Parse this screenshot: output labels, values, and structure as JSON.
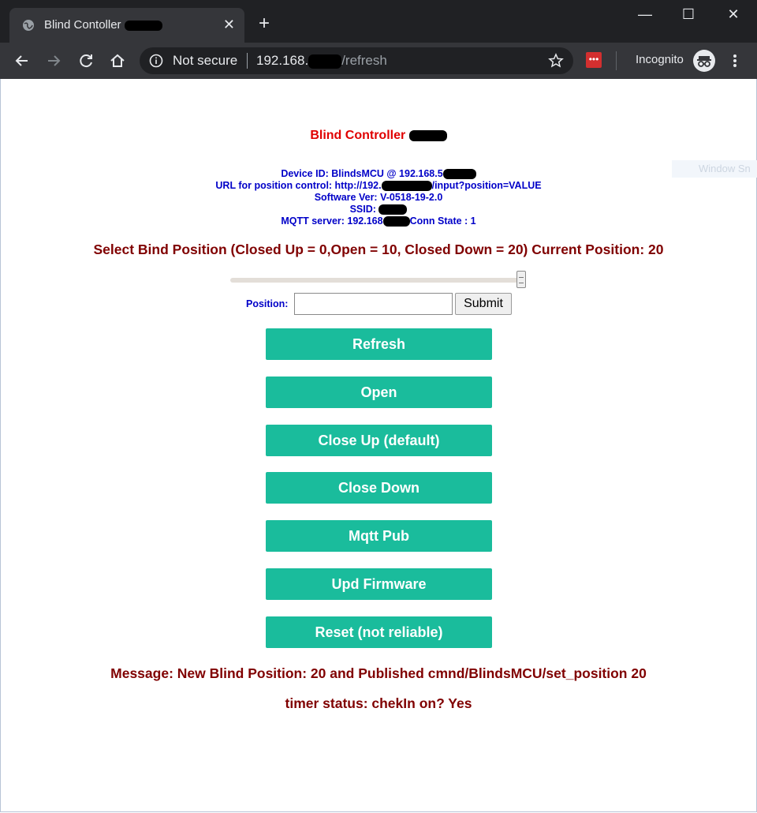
{
  "browser": {
    "tab_title": "Blind Contoller",
    "new_tab_symbol": "+",
    "close_tab_symbol": "✕",
    "security_label": "Not secure",
    "url_host": "192.168.",
    "url_path": "/refresh",
    "incognito_label": "Incognito",
    "window_controls": {
      "minimize": "—",
      "maximize": "☐",
      "close": "✕"
    }
  },
  "ghost_window_snap": "Window Sn",
  "page": {
    "title": "Blind Controller",
    "device_id": "Device ID: BlindsMCU @ 192.168.5",
    "url_control_prefix": "URL for position control: http://192.",
    "url_control_suffix": "/input?position=VALUE",
    "software_ver": "Software Ver: V-0518-19-2.0",
    "ssid": "SSID:",
    "mqtt_prefix": "MQTT server: 192.168",
    "mqtt_suffix": "Conn State : 1",
    "select_prompt": "Select Bind Position (Closed Up = 0,Open = 10, Closed Down = 20) Current Position: 20",
    "slider": {
      "min": 0,
      "max": 20,
      "value": 20
    },
    "position_label": "Position:",
    "position_value": "",
    "submit_label": "Submit",
    "buttons": [
      "Refresh",
      "Open",
      "Close Up (default)",
      "Close Down",
      "Mqtt Pub",
      "Upd Firmware",
      "Reset (not reliable)"
    ],
    "message": "Message: New Blind Position: 20 and Published cmnd/BlindsMCU/set_position 20",
    "timer_status": "timer status: chekIn on? Yes"
  },
  "colors": {
    "accent_button": "#1abc9c",
    "heading_red": "#e00000",
    "info_blue": "#0000c8",
    "maroon": "#800000"
  },
  "icons": [
    "globe-icon",
    "close-icon",
    "plus-icon",
    "back-icon",
    "forward-icon",
    "reload-icon",
    "home-icon",
    "info-icon",
    "star-icon",
    "lastpass-icon",
    "incognito-icon",
    "kebab-menu-icon"
  ]
}
